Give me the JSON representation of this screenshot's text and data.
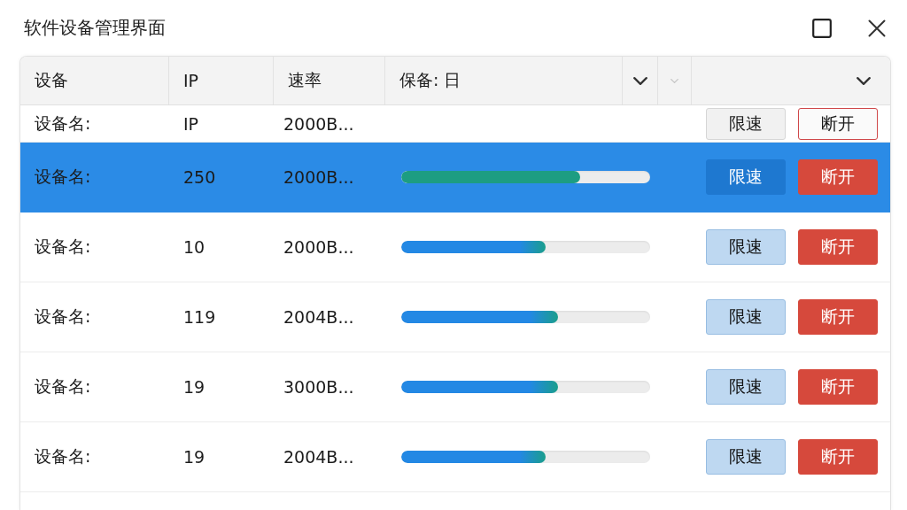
{
  "window": {
    "title": "软件设备管理界面"
  },
  "table": {
    "header": [
      {
        "kind": "label",
        "label": "设备"
      },
      {
        "kind": "label",
        "label": "IP"
      },
      {
        "kind": "label",
        "label": "速率"
      },
      {
        "kind": "label",
        "label": "保备: 日"
      },
      {
        "kind": "menu",
        "disabled": false
      },
      {
        "kind": "menu",
        "disabled": true
      },
      {
        "kind": "menu",
        "disabled": false
      }
    ],
    "rows": [
      {
        "kind": "plain",
        "selected": false,
        "name": "设备名:",
        "ip": "IP",
        "rate": "2000B...",
        "limit_button": "限速",
        "disconnect_button": "断开"
      },
      {
        "kind": "meter",
        "selected": true,
        "name": "设备名:",
        "ip": "250",
        "rate": "2000B...",
        "level": 0.72,
        "limit_button": "限速",
        "disconnect_button": "断开"
      },
      {
        "kind": "meter",
        "selected": false,
        "name": "设备名:",
        "ip": "10",
        "rate": "2000B...",
        "level": 0.58,
        "limit_button": "限速",
        "disconnect_button": "断开"
      },
      {
        "kind": "meter",
        "selected": false,
        "name": "设备名:",
        "ip": "119",
        "rate": "2004B...",
        "level": 0.63,
        "limit_button": "限速",
        "disconnect_button": "断开"
      },
      {
        "kind": "meter",
        "selected": false,
        "name": "设备名:",
        "ip": "19",
        "rate": "3000B...",
        "level": 0.63,
        "limit_button": "限速",
        "disconnect_button": "断开"
      },
      {
        "kind": "meter",
        "selected": false,
        "name": "设备名:",
        "ip": "19",
        "rate": "2004B...",
        "level": 0.58,
        "limit_button": "限速",
        "disconnect_button": "断开"
      }
    ]
  }
}
